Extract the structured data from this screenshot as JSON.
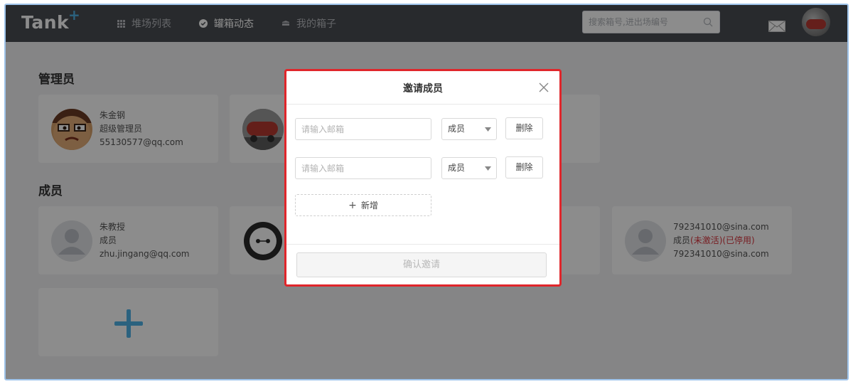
{
  "app": {
    "logo": "Tank",
    "logo_plus": "+"
  },
  "nav": {
    "items": [
      {
        "label": "堆场列表",
        "icon": "grid-icon",
        "active": false
      },
      {
        "label": "罐箱动态",
        "icon": "check-circle-icon",
        "active": true
      },
      {
        "label": "我的箱子",
        "icon": "box-icon",
        "active": false
      }
    ]
  },
  "search": {
    "placeholder": "搜索箱号,进出场编号"
  },
  "sections": {
    "admin_title": "管理员",
    "member_title": "成员"
  },
  "admins": [
    {
      "name": "朱金钢",
      "role": "超级管理员",
      "email": "55130577@qq.com"
    }
  ],
  "members": [
    {
      "name": "朱教授",
      "role": "成员",
      "email": "zhu.jingang@qq.com"
    },
    {
      "name": "792341010@sina.com",
      "role": "成员",
      "status": "(未激活)(已停用)",
      "email": "792341010@sina.com"
    }
  ],
  "modal": {
    "title": "邀请成员",
    "rows": [
      {
        "placeholder": "请输入邮箱",
        "role": "成员",
        "delete_label": "删除"
      },
      {
        "placeholder": "请输入邮箱",
        "role": "成员",
        "delete_label": "删除"
      }
    ],
    "add_label": "新增",
    "confirm_label": "确认邀请"
  },
  "colors": {
    "topbar": "#4a4d52",
    "accent": "#4fb3e8",
    "modal_border": "#e0262b",
    "status_red": "#d9363e"
  }
}
